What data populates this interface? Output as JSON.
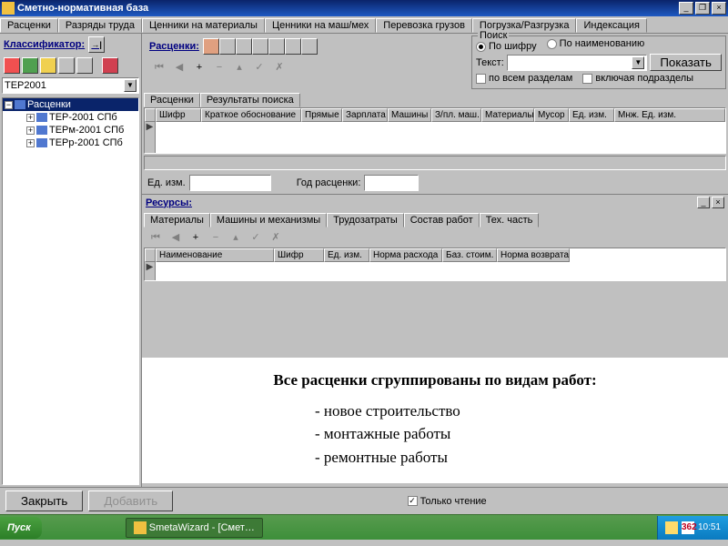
{
  "titlebar": {
    "title": "Сметно-нормативная база"
  },
  "mainTabs": [
    "Расценки",
    "Разряды труда",
    "Ценники на материалы",
    "Ценники на маш/мех",
    "Перевозка грузов",
    "Погрузка/Разгрузка",
    "Индексация"
  ],
  "classifier": {
    "title": "Классификатор:",
    "combo": "ТЕР2001",
    "root": "Расценки",
    "children": [
      "ТЕР-2001 СПб",
      "ТЕРм-2001 СПб",
      "ТЕРр-2001 СПб"
    ]
  },
  "rates": {
    "title": "Расценки:"
  },
  "search": {
    "legend": "Поиск",
    "radio1": "По шифру",
    "radio2": "По наименованию",
    "textLabel": "Текст:",
    "showBtn": "Показать",
    "chk1": "по всем разделам",
    "chk2": "включая подразделы"
  },
  "resultTabs": [
    "Расценки",
    "Результаты поиска"
  ],
  "gridCols1": [
    "Шифр",
    "Краткое обоснование",
    "Прямые",
    "Зарплата",
    "Машины",
    "З/пл. маш.",
    "Материалы",
    "Мусор",
    "Ед. изм.",
    "Мнж. Ед. изм."
  ],
  "unitRow": {
    "l1": "Ед. изм.",
    "l2": "Год расценки:"
  },
  "resources": {
    "title": "Ресурсы:"
  },
  "resTabs": [
    "Материалы",
    "Машины и механизмы",
    "Трудозатраты",
    "Состав работ",
    "Тех. часть"
  ],
  "gridCols2": [
    "Наименование",
    "Шифр",
    "Ед. изм.",
    "Норма расхода",
    "Баз. стоим.",
    "Норма возврата"
  ],
  "overlay": {
    "header": "Все расценки сгруппированы по видам работ:",
    "items": [
      "- новое строительство",
      "- монтажные работы",
      "- ремонтные работы"
    ]
  },
  "footer": {
    "close": "Закрыть",
    "add": "Добавить",
    "readonly": "Только чтение"
  },
  "taskbar": {
    "start": "Пуск",
    "task": "SmetaWizard - [Смет…",
    "lang": "362",
    "time": "10:51"
  }
}
